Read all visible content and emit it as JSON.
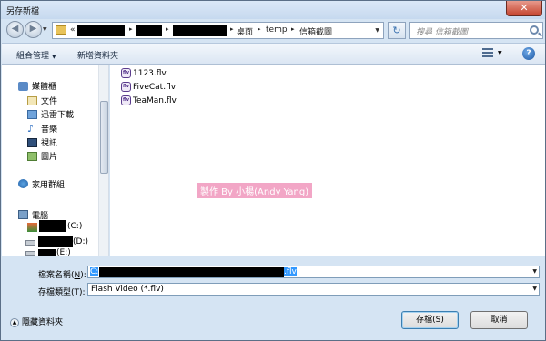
{
  "window": {
    "title": "另存新檔",
    "close_glyph": "✕"
  },
  "nav": {
    "back_glyph": "◀",
    "forward_glyph": "▶"
  },
  "address": {
    "prefix": "«",
    "segments": [
      "桌面",
      "temp",
      "信箱截圖"
    ],
    "sep": "▸"
  },
  "search": {
    "placeholder": "搜尋 信箱截圖"
  },
  "toolbar": {
    "organize": "組合管理",
    "new_folder": "新增資料夾",
    "help": "?"
  },
  "sidebar": {
    "favorites_label": "媒體櫃",
    "items": [
      "文件",
      "迅雷下載",
      "音樂",
      "視訊",
      "圖片"
    ],
    "homegroup": "家用群組",
    "computer": "電腦",
    "drives": [
      "(C:)",
      "(D:)",
      "(E:)"
    ]
  },
  "files": [
    "1123.flv",
    "FiveCat.flv",
    "TeaMan.flv"
  ],
  "file_icon_text": "flv",
  "watermark": "製作 By 小楊(Andy Yang)",
  "filename": {
    "label_main": "檔案名稱(",
    "label_key": "N",
    "label_end": "):",
    "value_prefix": "C:",
    "value_suffix": ".flv"
  },
  "filetype": {
    "label_main": "存檔類型(",
    "label_key": "T",
    "label_end": "):",
    "value": "Flash Video (*.flv)"
  },
  "footer": {
    "hide_folders": "隱藏資料夾",
    "save": "存檔(S)",
    "cancel": "取消"
  },
  "colors": {
    "accent": "#3399ff",
    "watermark_bg": "#f2a6c6",
    "dialog_bg": "#d5e4f3"
  }
}
